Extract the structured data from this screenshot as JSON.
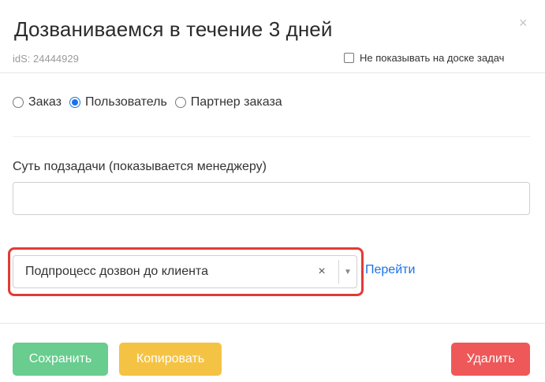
{
  "modal": {
    "title": "Дозваниваемся в течение 3 дней",
    "ids": "idS: 24444929",
    "hide_from_board_label": "Не показывать на доске задач"
  },
  "radio_group": {
    "options": [
      {
        "label": "Заказ",
        "checked": false
      },
      {
        "label": "Пользователь",
        "checked": true
      },
      {
        "label": "Партнер заказа",
        "checked": false
      }
    ]
  },
  "subtask": {
    "label": "Суть подзадачи (показывается менеджеру)",
    "value": ""
  },
  "subprocess": {
    "selected": "Подпроцесс дозвон до клиента",
    "link_label": "Перейти"
  },
  "buttons": {
    "save": "Сохранить",
    "copy": "Копировать",
    "delete": "Удалить"
  },
  "colors": {
    "accent": "#1a73e8",
    "save": "#68cd8e",
    "copy": "#f5c344",
    "delete": "#ee5858",
    "highlight": "#e23b35"
  },
  "icons": {
    "close": "×",
    "clear": "×",
    "dropdown": "▼"
  }
}
